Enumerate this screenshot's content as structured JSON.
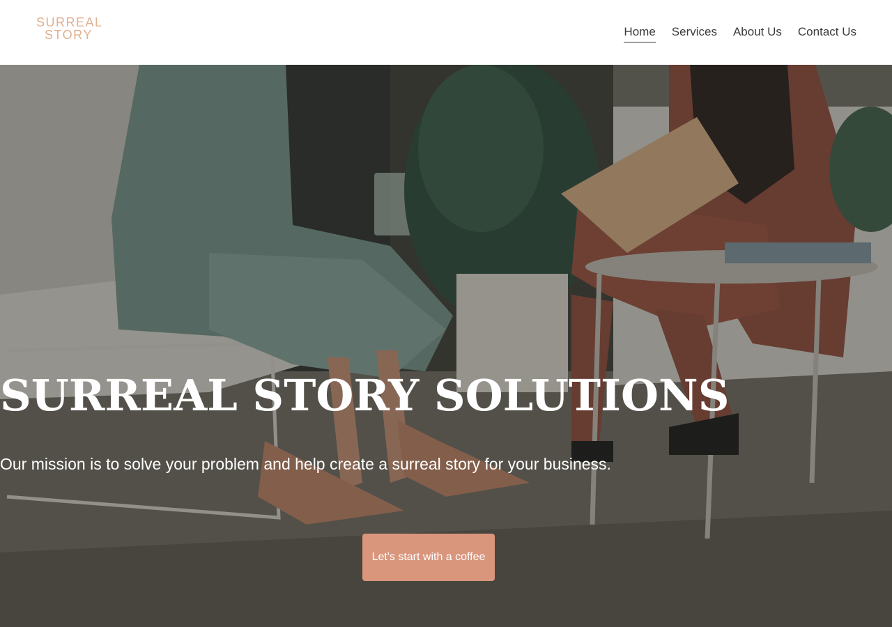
{
  "header": {
    "logo_line1": "SURREAL",
    "logo_line2": "STORY",
    "logo_color": "#e0b090",
    "nav": [
      {
        "label": "Home",
        "active": true
      },
      {
        "label": "Services",
        "active": false
      },
      {
        "label": "About Us",
        "active": false
      },
      {
        "label": "Contact Us",
        "active": false
      }
    ]
  },
  "hero": {
    "title": "SURREAL STORY SOLUTIONS",
    "subtitle": "Our mission is to solve your problem and help create a surreal story for your business.",
    "cta_label": "Let's start with a coffee",
    "cta_color": "#d9967d"
  }
}
